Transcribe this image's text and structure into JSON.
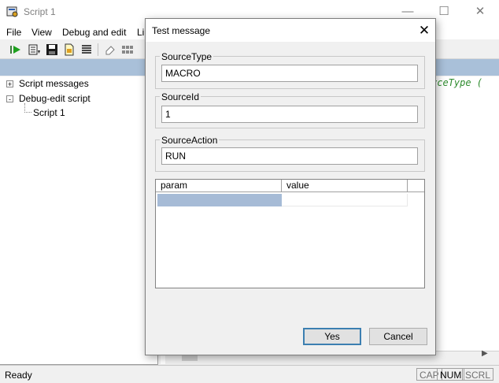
{
  "window": {
    "title": "Script 1"
  },
  "menu": {
    "items": [
      "File",
      "View",
      "Debug and edit",
      "Li"
    ]
  },
  "tree": {
    "items": [
      {
        "label": "Script messages",
        "expander": "+"
      },
      {
        "label": "Debug-edit script",
        "expander": "-"
      },
      {
        "label": "Script 1"
      }
    ]
  },
  "editor": {
    "code_fragment": "rceType ("
  },
  "status": {
    "text": "Ready",
    "indicators": [
      "CAP",
      "NUM",
      "SCRL"
    ]
  },
  "dialog": {
    "title": "Test message",
    "close_glyph": "✕",
    "fields": [
      {
        "label": "SourceType",
        "value": "MACRO"
      },
      {
        "label": "SourceId",
        "value": "1"
      },
      {
        "label": "SourceAction",
        "value": "RUN"
      }
    ],
    "grid": {
      "columns": [
        "param",
        "value"
      ]
    },
    "yes_label": "Yes",
    "cancel_label": "Cancel"
  },
  "icons": [
    "app-icon",
    "run-icon",
    "list-icon",
    "save-icon",
    "page-icon",
    "lines-icon",
    "eraser-icon",
    "grid-icon",
    "minimize-icon",
    "maximize-icon",
    "close-icon",
    "scroll-left-icon",
    "scroll-right-icon"
  ],
  "colors": {
    "selection_band": "#a9c0d9",
    "grid_selection": "#a6bbd6",
    "code": "#2e8b2e",
    "default_button_border": "#3c7fb1"
  }
}
